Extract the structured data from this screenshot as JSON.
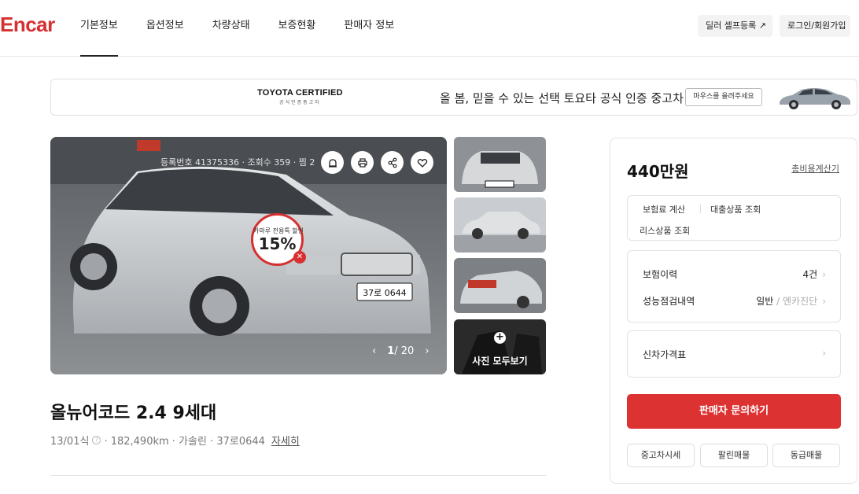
{
  "header": {
    "logo": "Encar",
    "nav": [
      "기본정보",
      "옵션정보",
      "차량상태",
      "보증현황",
      "판매자 정보"
    ],
    "self_register": "딜러 셀프등록 ↗",
    "login": "로그인/회원가입"
  },
  "banner": {
    "logo_title": "TOYOTA CERTIFIED",
    "logo_sub": "공식인증중고차",
    "text": "올 봄, 믿을 수 있는 선택 토요타 공식 인증 중고차",
    "hover_hint": "마우스를 올려주세요"
  },
  "photo": {
    "overlay_text": "등록번호 41375336 · 조회수 359 · 찜 2",
    "badge_line1": "카마루 전용특 할인",
    "badge_value": "15%",
    "page_current": "1",
    "page_total": "/ 20",
    "view_all": "사진 모두보기",
    "plate": "37로 0644"
  },
  "car": {
    "title": "올뉴어코드 2.4 9세대",
    "meta_year": "13/01식",
    "meta_rest": "· 182,490km · 가솔린 · 37로0644",
    "detail_link": "자세히"
  },
  "panel": {
    "price": "440만원",
    "cost_link": "총비용계산기",
    "insurance_calc": "보험료 계산",
    "loan": "대출상품 조회",
    "lease": "리스상품 조회",
    "insurance_history_label": "보험이력",
    "insurance_history_value": "4건",
    "inspection_label": "성능점검내역",
    "inspection_value": "일반",
    "inspection_value_muted": "/ 엔카진단",
    "new_price_label": "신차가격표",
    "cta": "판매자 문의하기",
    "btn_market": "중고차시세",
    "btn_sold": "팔린매물",
    "btn_similar": "동급매물"
  },
  "colors": {
    "brand": "#d63031",
    "cta": "#dc3232"
  }
}
